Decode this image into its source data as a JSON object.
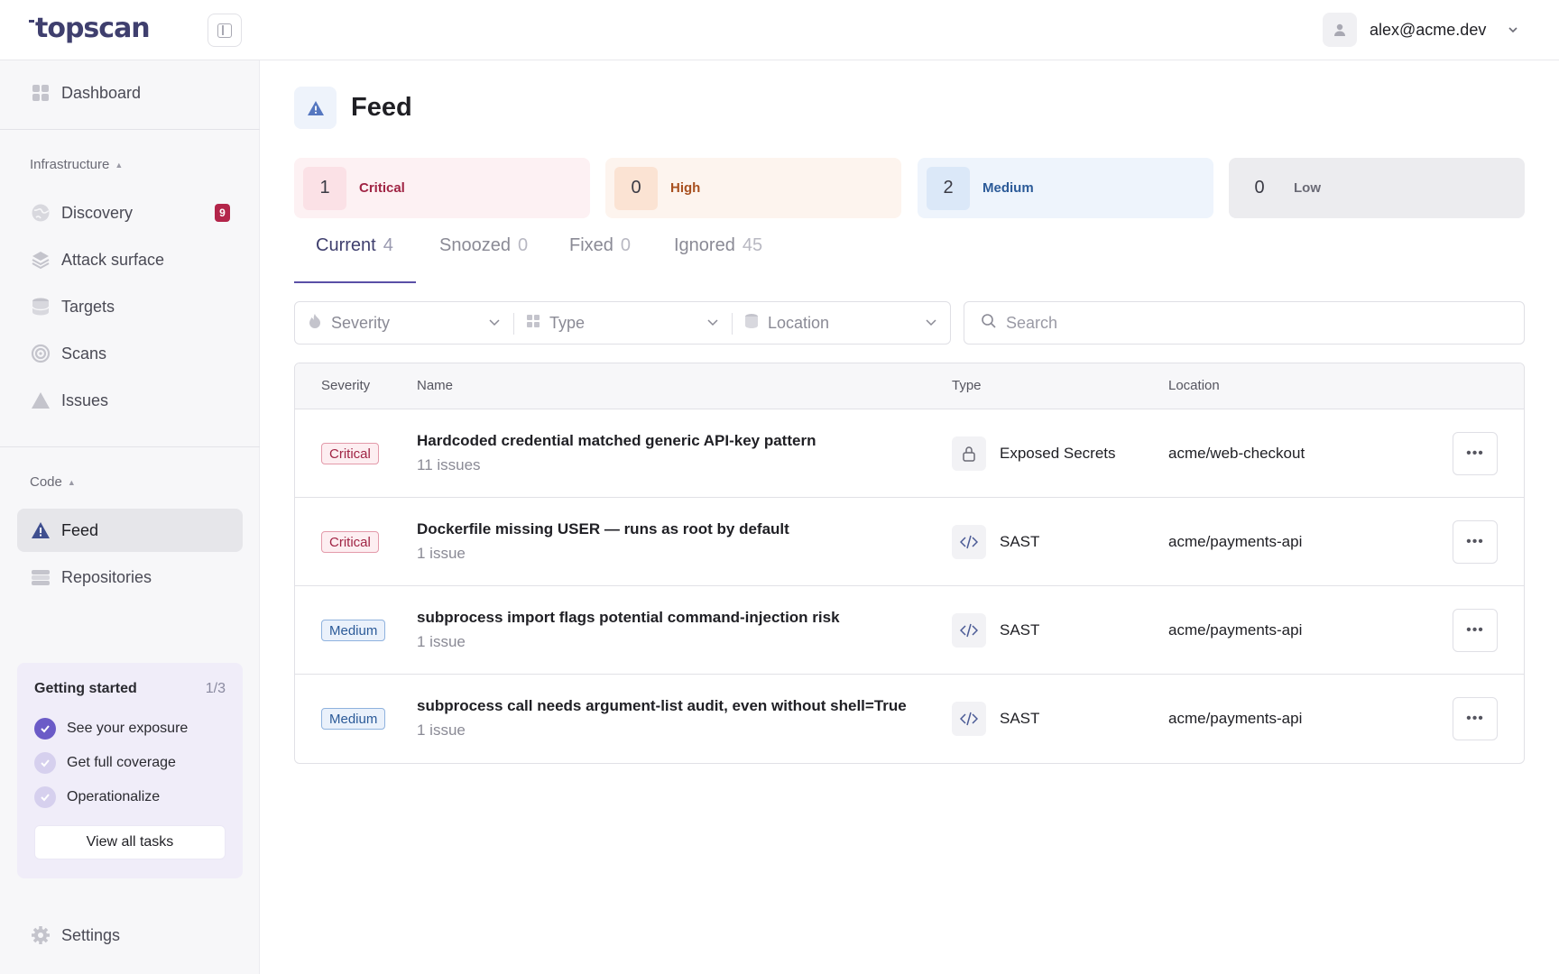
{
  "app": {
    "logo": "topscan"
  },
  "header": {
    "user_email": "alex@acme.dev"
  },
  "sidebar": {
    "dashboard": "Dashboard",
    "infrastructure_label": "Infrastructure",
    "infra_items": [
      {
        "label": "Discovery",
        "badge": "9",
        "icon": "globe-icon"
      },
      {
        "label": "Attack surface",
        "icon": "layers-icon"
      },
      {
        "label": "Targets",
        "icon": "database-icon"
      },
      {
        "label": "Scans",
        "icon": "target-icon"
      },
      {
        "label": "Issues",
        "icon": "warning-icon"
      }
    ],
    "code_label": "Code",
    "code_items": [
      {
        "label": "Feed",
        "icon": "warning-icon",
        "active": true
      },
      {
        "label": "Repositories",
        "icon": "stack-icon"
      }
    ],
    "settings": "Settings"
  },
  "getting_started": {
    "title": "Getting started",
    "progress": "1/3",
    "items": [
      {
        "label": "See your exposure",
        "done": true
      },
      {
        "label": "Get full coverage",
        "done": false
      },
      {
        "label": "Operationalize",
        "done": false
      }
    ],
    "button": "View all tasks"
  },
  "page": {
    "title": "Feed"
  },
  "severity_summary": [
    {
      "count": "1",
      "label": "Critical",
      "bg": "#fdf1f3",
      "num_bg": "#fbe1e6",
      "color": "#a02444"
    },
    {
      "count": "0",
      "label": "High",
      "bg": "#fdf4ee",
      "num_bg": "#fbe3d3",
      "color": "#a8501f"
    },
    {
      "count": "2",
      "label": "Medium",
      "bg": "#eef4fc",
      "num_bg": "#dbe8f8",
      "color": "#2b5a98"
    },
    {
      "count": "0",
      "label": "Low",
      "bg": "#ececef",
      "num_bg": "#ececef",
      "color": "#6a6a75"
    }
  ],
  "tabs": [
    {
      "label": "Current",
      "count": "4",
      "active": true
    },
    {
      "label": "Snoozed",
      "count": "0"
    },
    {
      "label": "Fixed",
      "count": "0"
    },
    {
      "label": "Ignored",
      "count": "45"
    }
  ],
  "filters": {
    "severity": "Severity",
    "type": "Type",
    "location": "Location",
    "search_placeholder": "Search"
  },
  "table": {
    "columns": {
      "severity": "Severity",
      "name": "Name",
      "type": "Type",
      "location": "Location"
    },
    "rows": [
      {
        "severity": "Critical",
        "level": "critical",
        "name": "Hardcoded credential matched generic API-key pattern",
        "count": "11 issues",
        "type": "Exposed Secrets",
        "type_icon": "lock-icon",
        "location": "acme/web-checkout"
      },
      {
        "severity": "Critical",
        "level": "critical",
        "name": "Dockerfile missing USER — runs as root by default",
        "count": "1 issue",
        "type": "SAST",
        "type_icon": "code-icon",
        "location": "acme/payments-api"
      },
      {
        "severity": "Medium",
        "level": "medium",
        "name": "subprocess import flags potential command-injection risk",
        "count": "1 issue",
        "type": "SAST",
        "type_icon": "code-icon",
        "location": "acme/payments-api"
      },
      {
        "severity": "Medium",
        "level": "medium",
        "name": "subprocess call needs argument-list audit, even without shell=True",
        "count": "1 issue",
        "type": "SAST",
        "type_icon": "code-icon",
        "location": "acme/payments-api"
      }
    ]
  }
}
